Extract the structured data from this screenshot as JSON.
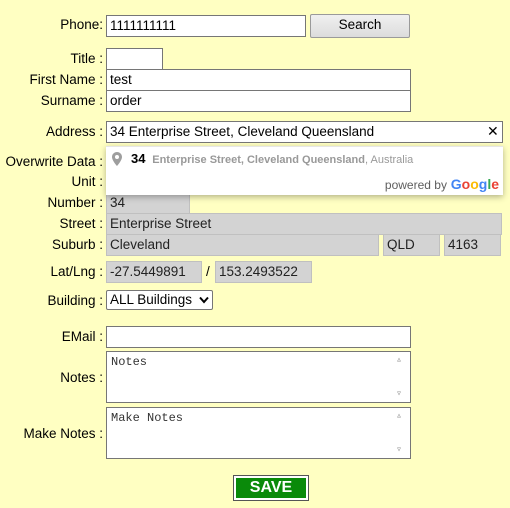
{
  "form": {
    "phone_label": "Phone:",
    "phone_value": "1111111111",
    "search_label": "Search",
    "title_label": "Title :",
    "title_value": "",
    "first_name_label": "First Name :",
    "first_name_value": "test",
    "surname_label": "Surname :",
    "surname_value": "order",
    "address_label": "Address :",
    "address_value": "34 Enterprise Street, Cleveland Queensland",
    "overwrite_label": "Overwrite Data :",
    "unit_label": "Unit :",
    "number_label": "Number :",
    "number_value": "34",
    "street_label": "Street :",
    "street_value": "Enterprise Street",
    "suburb_label": "Suburb :",
    "suburb_value": "Cleveland",
    "state_value": "QLD",
    "postcode_value": "4163",
    "latlng_label": "Lat/Lng :",
    "lat_value": "-27.5449891",
    "latlng_separator": "/",
    "lng_value": "153.2493522",
    "building_label": "Building :",
    "building_value": "ALL Buildings",
    "email_label": "EMail :",
    "email_value": "",
    "notes_label": "Notes :",
    "notes_placeholder": "Notes",
    "make_notes_label": "Make Notes :",
    "make_notes_placeholder": "Make Notes",
    "save_label": "SAVE"
  },
  "autocomplete": {
    "main_text": "34",
    "secondary_bold": "Enterprise Street, Cleveland Queensland",
    "secondary_rest": ", Australia",
    "powered_by": "powered by",
    "brand": "Google",
    "brand_colors": [
      "#4285F4",
      "#EA4335",
      "#FBBC05",
      "#4285F4",
      "#34A853",
      "#EA4335"
    ]
  },
  "colors": {
    "background": "#ffffc2",
    "save_button": "#0a8a0a",
    "readonly_field": "#d3d3d3"
  }
}
